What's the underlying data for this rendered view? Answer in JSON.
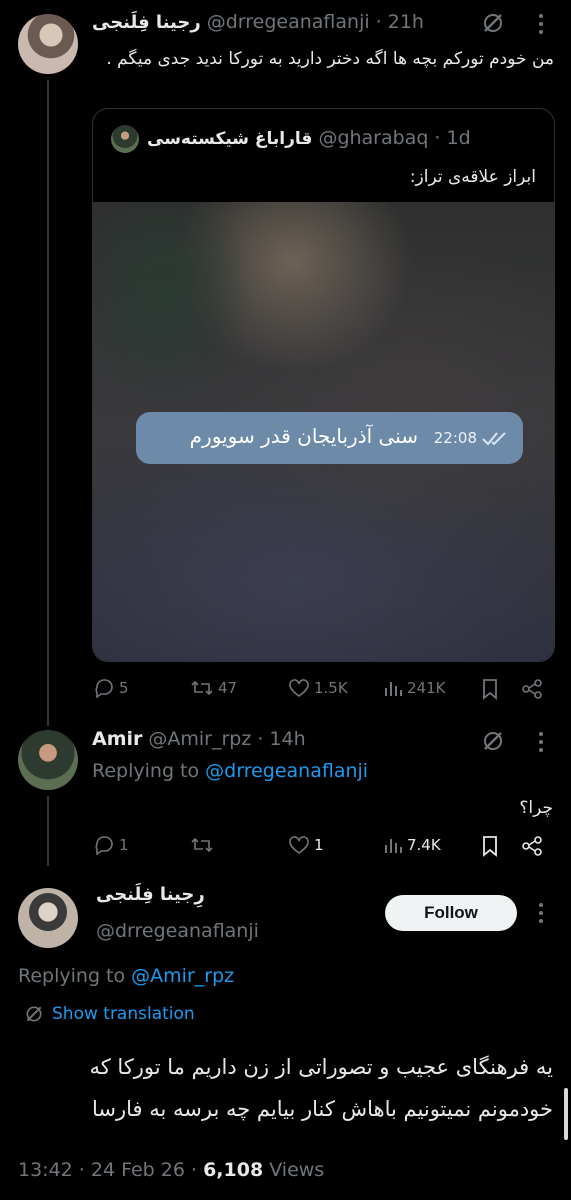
{
  "colors": {
    "background": "#000000",
    "text": "#e7e9ea",
    "muted": "#71767b",
    "link": "#1d9bf0",
    "bubble": "#6d8aa9"
  },
  "tweet1": {
    "name": "رجینا فِلَنجی",
    "handle": "@drregeanaflanji",
    "time": "· 21h",
    "text": "من خودم تورکم بچه ها اگه دختر دارید به تورکا ندید جدی میگم .",
    "quote": {
      "name": "قاراباغ شیکسته‌سی",
      "handle": "@gharabaq",
      "time": "· 1d",
      "text": "ابراز علاقه‌ی تراز:",
      "bubble_text": "سنی آذربایجان قدر سویورم",
      "bubble_time": "22:08"
    },
    "actions": {
      "replies": "5",
      "reposts": "47",
      "likes": "1.5K",
      "views": "241K"
    }
  },
  "tweet2": {
    "name": "Amir",
    "handle": "@Amir_rpz",
    "time": "· 14h",
    "replying_label": "Replying to ",
    "replying_to": "@drregeanaflanji",
    "text": "چرا؟",
    "actions": {
      "replies": "1",
      "reposts": "",
      "likes": "1",
      "views": "7.4K"
    }
  },
  "tweet3": {
    "name": "رِجینا فِلَنجی",
    "handle": "@drregeanaflanji",
    "follow_label": "Follow",
    "replying_label": "Replying to ",
    "replying_to": "@Amir_rpz",
    "translation_label": "Show translation",
    "text": "یه فرهنگای عجیب و تصوراتی از زن داریم ما تورکا که خودمونم نمیتونیم باهاش کنار بیایم چه برسه به فارسا",
    "timestamp": "13:42 · 24 Feb 26 · ",
    "views_count": "6,108",
    "views_label": " Views"
  }
}
